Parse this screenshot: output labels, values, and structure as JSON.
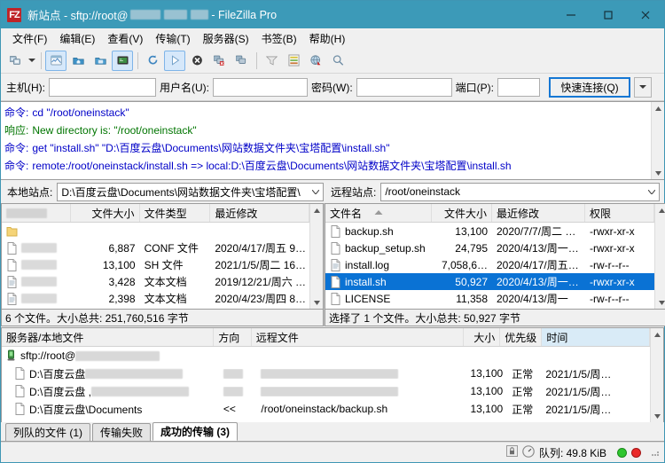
{
  "window": {
    "title_prefix": "新站点 - sftp://root@",
    "title_suffix": " - FileZilla Pro",
    "logo_text": "FZ",
    "minimize": "–",
    "maximize": "□",
    "close": "✕",
    "accent_color": "#3c9ab8",
    "logo_color": "#bf2428"
  },
  "menubar": {
    "items": [
      {
        "label": "文件(F)"
      },
      {
        "label": "编辑(E)"
      },
      {
        "label": "查看(V)"
      },
      {
        "label": "传输(T)"
      },
      {
        "label": "服务器(S)"
      },
      {
        "label": "书签(B)"
      },
      {
        "label": "帮助(H)"
      }
    ]
  },
  "toolbar": {
    "buttons": [
      {
        "name": "site-manager-icon",
        "active": false
      },
      {
        "name": "site-manager-dropdown-caret",
        "active": false
      },
      {
        "name": "toggle-message-log-icon",
        "active": true
      },
      {
        "name": "toggle-local-tree-icon",
        "active": false
      },
      {
        "name": "toggle-remote-tree-icon",
        "active": false
      },
      {
        "name": "toggle-transfer-queue-icon",
        "active": true
      },
      {
        "name": "refresh-icon",
        "active": false
      },
      {
        "name": "process-queue-icon",
        "active": true
      },
      {
        "name": "cancel-operation-icon",
        "active": false
      },
      {
        "name": "disconnect-icon",
        "active": false
      },
      {
        "name": "reconnect-icon",
        "active": false
      },
      {
        "name": "filter-icon",
        "active": false
      },
      {
        "name": "directory-comparison-icon",
        "active": false
      },
      {
        "name": "synchronized-browsing-icon",
        "active": false
      },
      {
        "name": "search-remote-files-icon",
        "active": false
      }
    ]
  },
  "quickconnect": {
    "host_label": "主机(H):",
    "host_value": "",
    "user_label": "用户名(U):",
    "user_value": "",
    "pass_label": "密码(W):",
    "pass_value": "",
    "port_label": "端口(P):",
    "port_value": "",
    "connect_label": "快速连接(Q)",
    "dropdown_caret": "▾"
  },
  "log": {
    "entries": [
      {
        "key": "命令:",
        "key_type": "command",
        "text": "cd \"/root/oneinstack\""
      },
      {
        "key": "响应:",
        "key_type": "response",
        "text": "New directory is: \"/root/oneinstack\""
      },
      {
        "key": "命令:",
        "key_type": "command",
        "text": "get \"install.sh\" \"D:\\百度云盘\\Documents\\网站数据文件夹\\宝塔配置\\install.sh\""
      },
      {
        "key": "命令:",
        "key_type": "command",
        "text": "remote:/root/oneinstack/install.sh => local:D:\\百度云盘\\Documents\\网站数据文件夹\\宝塔配置\\install.sh"
      }
    ],
    "scroll_up": "⌃",
    "scroll_down": "⌄"
  },
  "local": {
    "site_label": "本地站点:",
    "site_path": "D:\\百度云盘\\Documents\\网站数据文件夹\\宝塔配置\\",
    "columns": [
      {
        "label": "",
        "key": "name",
        "redacted": true
      },
      {
        "label": "文件大小",
        "key": "size"
      },
      {
        "label": "文件类型",
        "key": "type"
      },
      {
        "label": "最近修改",
        "key": "modified"
      }
    ],
    "rows": [
      {
        "icon": "folder-icon",
        "name": "",
        "size": "",
        "type": "",
        "modified": "",
        "redacted": true
      },
      {
        "icon": "file-icon",
        "name": "",
        "size": "6,887",
        "type": "CONF 文件",
        "modified": "2020/4/17/周五 9…",
        "redacted": true
      },
      {
        "icon": "file-icon",
        "name": "",
        "size": "13,100",
        "type": "SH 文件",
        "modified": "2021/1/5/周二 16…",
        "redacted": true
      },
      {
        "icon": "text-file-icon",
        "name": "",
        "size": "3,428",
        "type": "文本文档",
        "modified": "2019/12/21/周六 …",
        "redacted": true
      },
      {
        "icon": "text-file-icon",
        "name": "",
        "size": "2,398",
        "type": "文本文档",
        "modified": "2020/4/23/周四 8…",
        "redacted": true
      }
    ],
    "status": "6 个文件。大小总共: 251,760,516 字节"
  },
  "remote": {
    "site_label": "远程站点:",
    "site_path": "/root/oneinstack",
    "columns": [
      {
        "label": "文件名",
        "key": "name",
        "sorted": true
      },
      {
        "label": "文件大小",
        "key": "size"
      },
      {
        "label": "最近修改",
        "key": "modified"
      },
      {
        "label": "权限",
        "key": "perms"
      }
    ],
    "rows": [
      {
        "icon": "file-icon",
        "name": "backup.sh",
        "size": "13,100",
        "modified": "2020/7/7/周二 …",
        "perms": "-rwxr-xr-x",
        "selected": false
      },
      {
        "icon": "file-icon",
        "name": "backup_setup.sh",
        "size": "24,795",
        "modified": "2020/4/13/周一…",
        "perms": "-rwxr-xr-x",
        "selected": false
      },
      {
        "icon": "text-file-icon",
        "name": "install.log",
        "size": "7,058,6…",
        "modified": "2020/4/17/周五…",
        "perms": "-rw-r--r--",
        "selected": false
      },
      {
        "icon": "file-icon",
        "name": "install.sh",
        "size": "50,927",
        "modified": "2020/4/13/周一…",
        "perms": "-rwxr-xr-x",
        "selected": true
      },
      {
        "icon": "file-icon",
        "name": "LICENSE",
        "size": "11,358",
        "modified": "2020/4/13/周一",
        "perms": "-rw-r--r--",
        "selected": false
      }
    ],
    "status": "选择了 1 个文件。大小总共: 50,927 字节"
  },
  "queue": {
    "columns": [
      {
        "label": "服务器/本地文件",
        "key": "local"
      },
      {
        "label": "方向",
        "key": "direction"
      },
      {
        "label": "远程文件",
        "key": "remote"
      },
      {
        "label": "大小",
        "key": "size"
      },
      {
        "label": "优先级",
        "key": "priority"
      },
      {
        "label": "时间",
        "key": "time",
        "highlight": true
      }
    ],
    "rows": [
      {
        "type": "server",
        "icon": "server-icon",
        "local": "sftp://root@",
        "local_redacted": true,
        "direction": "",
        "remote": "",
        "size": "",
        "priority": "",
        "time": ""
      },
      {
        "type": "file",
        "icon": "file-icon",
        "local": "D:\\百度云盘",
        "local_redacted": true,
        "direction": "",
        "direction_redacted": true,
        "remote": "",
        "remote_redacted": true,
        "size": "13,100",
        "priority": "正常",
        "time": "2021/1/5/周…"
      },
      {
        "type": "file",
        "icon": "file-icon",
        "local": "D:\\百度云盘 ,",
        "local_redacted": true,
        "direction": "",
        "direction_redacted": true,
        "remote": "",
        "remote_redacted": true,
        "size": "13,100",
        "priority": "正常",
        "time": "2021/1/5/周…"
      },
      {
        "type": "file",
        "icon": "file-icon",
        "local": "D:\\百度云盘\\Documents",
        "local_redacted": false,
        "direction": "<<",
        "remote": "/root/oneinstack/backup.sh",
        "size": "13,100",
        "priority": "正常",
        "time": "2021/1/5/周…"
      }
    ]
  },
  "tabs": [
    {
      "label": "列队的文件 (1)",
      "active": false
    },
    {
      "label": "传输失败",
      "active": false
    },
    {
      "label": "成功的传输 (3)",
      "active": true
    }
  ],
  "statusbar": {
    "lock_icon": "lock-icon",
    "speed_icon": "gauge-icon",
    "queue_text": "队列: 49.8 KiB",
    "indicator_green": "#2fc62f",
    "indicator_red": "#ea2b2b"
  }
}
